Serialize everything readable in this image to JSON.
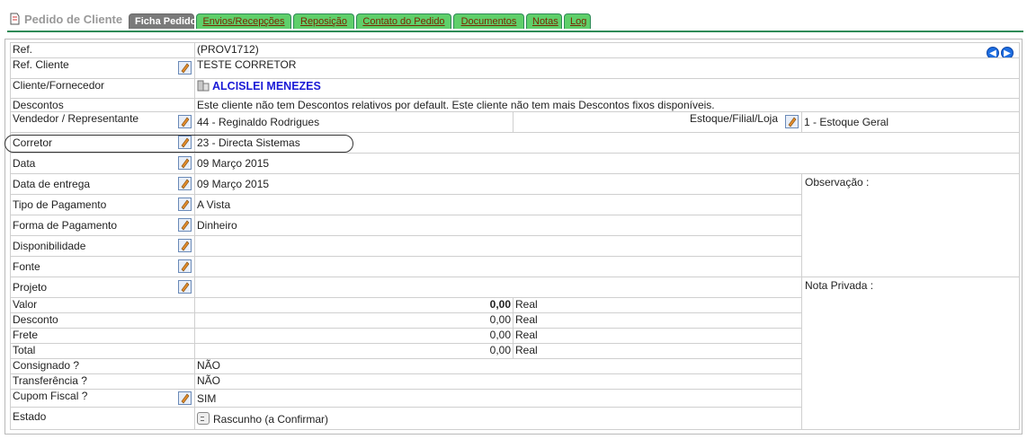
{
  "app_title": "Pedido de Cliente",
  "tabs": [
    {
      "label": "Ficha Pedido",
      "active": true
    },
    {
      "label": "Envios/Recepções"
    },
    {
      "label": "Reposição"
    },
    {
      "label": "Contato do Pedido"
    },
    {
      "label": "Documentos"
    },
    {
      "label": "Notas"
    },
    {
      "label": "Log"
    }
  ],
  "form": {
    "ref_label": "Ref.",
    "ref_value": "(PROV1712)",
    "ref_cliente_label": "Ref. Cliente",
    "ref_cliente_value": "TESTE CORRETOR",
    "cliente_label": "Cliente/Fornecedor",
    "cliente_value": "ALCISLEI MENEZES",
    "descontos_label": "Descontos",
    "descontos_value": "Este cliente não tem Descontos relativos por default. Este cliente não tem mais Descontos fixos disponíveis.",
    "vendedor_label": "Vendedor / Representante",
    "vendedor_value": "44 - Reginaldo Rodrigues",
    "estoque_label": "Estoque/Filial/Loja",
    "estoque_value": "1 - Estoque Geral",
    "corretor_label": "Corretor",
    "corretor_value": "23 - Directa Sistemas",
    "data_label": "Data",
    "data_value": "09 Março 2015",
    "entrega_label": "Data de entrega",
    "entrega_value": "09 Março 2015",
    "observacao_label": "Observação :",
    "tipo_pag_label": "Tipo de Pagamento",
    "tipo_pag_value": "A Vista",
    "forma_pag_label": "Forma de Pagamento",
    "forma_pag_value": "Dinheiro",
    "disponibilidade_label": "Disponibilidade",
    "fonte_label": "Fonte",
    "projeto_label": "Projeto",
    "nota_privada_label": "Nota Privada :",
    "valor_label": "Valor",
    "valor_value": "0,00",
    "desconto_label": "Desconto",
    "desconto_value": "0,00",
    "frete_label": "Frete",
    "frete_value": "0,00",
    "total_label": "Total",
    "total_value": "0,00",
    "currency": "Real",
    "consignado_label": "Consignado ?",
    "consignado_value": "NÃO",
    "transferencia_label": "Transferência ?",
    "transferencia_value": "NÃO",
    "cupom_label": "Cupom Fiscal ?",
    "cupom_value": "SIM",
    "estado_label": "Estado",
    "estado_value": "Rascunho (a Confirmar)"
  },
  "icons": {
    "edit": "pencil-edit-icon",
    "prev": "arrow-left-icon",
    "next": "arrow-right-icon",
    "client": "building-icon"
  },
  "colors": {
    "tab_green": "#5fcf6a",
    "tab_active": "#7a7a7a",
    "link_blue": "#1a1ad6"
  }
}
